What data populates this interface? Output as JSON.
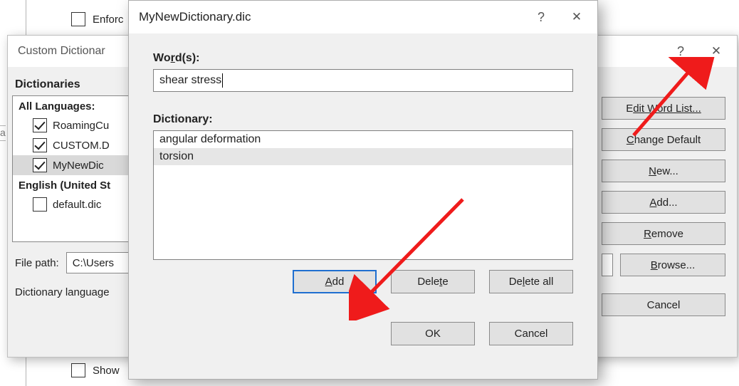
{
  "bg": {
    "top_checkbox_label": "Enforc",
    "bottom_checkbox_label": "Show",
    "left_sliver": "a"
  },
  "dlg1": {
    "title": "Custom Dictionar",
    "heading": "Dictionaries",
    "group_all": "All Languages:",
    "items_all": [
      "RoamingCu",
      "CUSTOM.D",
      "MyNewDic"
    ],
    "group_en": "English (United St",
    "items_en": [
      "default.dic"
    ],
    "file_path_label": "File path:",
    "file_path_value": "C:\\Users",
    "lang_label": "Dictionary language",
    "buttons": {
      "edit": "dit Word List...",
      "change": "hange Default",
      "new": "ew...",
      "add": "dd...",
      "remove": "emove",
      "browse": "rowse...",
      "cancel": "Cancel"
    }
  },
  "dlg2": {
    "title": "MyNewDictionary.dic",
    "word_label_pre": "Wo",
    "word_label_ul": "r",
    "word_label_post": "d(s):",
    "word_value": "shear stress",
    "dict_label": "Dictionary:",
    "dict_items": [
      "angular deformation",
      "torsion"
    ],
    "buttons": {
      "add_ul": "A",
      "add_post": "dd",
      "delete_pre": "Dele",
      "delete_ul": "t",
      "delete_post": "e",
      "deleteall_pre": "De",
      "deleteall_ul": "l",
      "deleteall_post": "ete all",
      "ok": "OK",
      "cancel": "Cancel"
    }
  }
}
